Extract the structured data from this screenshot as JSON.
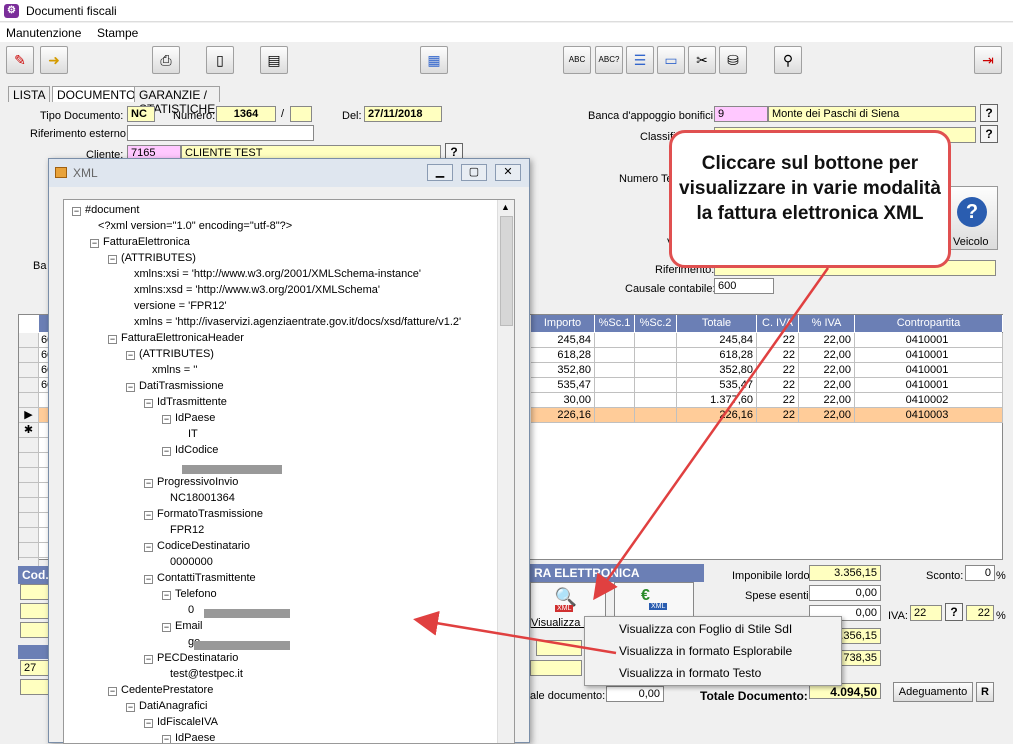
{
  "window": {
    "title": "Documenti fiscali"
  },
  "menu": [
    "Manutenzione",
    "Stampe"
  ],
  "tabs": [
    "LISTA",
    "DOCUMENTO",
    "GARANZIE / STATISTICHE"
  ],
  "form": {
    "tipo_label": "Tipo Documento:",
    "tipo_value": "NC",
    "numero_label": "Numero:",
    "numero_value": "1364",
    "numero_sep": "/",
    "del_label": "Del:",
    "del_value": "27/11/2018",
    "rif_label": "Riferimento esterno:",
    "cliente_label": "Cliente:",
    "cliente_code": "7165",
    "cliente_name": "CLIENTE TEST",
    "banca_label": "Banca d'appoggio bonifici:",
    "banca_code": "9",
    "banca_name": "Monte dei Paschi di Siena",
    "classif_label": "Classifi",
    "numero_te_label": "Numero Te",
    "veicolo_label": "Veicolo",
    "riferimento_label": "Riferimento:",
    "causale_label": "Causale contabile:",
    "causale_value": "600",
    "ba_label": "Ba",
    "v_label": "V"
  },
  "grid": {
    "headers": [
      "Importo",
      "%Sc.1",
      "%Sc.2",
      "Totale",
      "C. IVA",
      "% IVA",
      "Contropartita"
    ],
    "left_codes": [
      "60",
      "60",
      "60",
      "60"
    ],
    "rows": [
      [
        "245,84",
        "",
        "",
        "245,84",
        "22",
        "22,00",
        "0410001"
      ],
      [
        "618,28",
        "",
        "",
        "618,28",
        "22",
        "22,00",
        "0410001"
      ],
      [
        "352,80",
        "",
        "",
        "352,80",
        "22",
        "22,00",
        "0410001"
      ],
      [
        "535,47",
        "",
        "",
        "535,47",
        "22",
        "22,00",
        "0410001"
      ],
      [
        "30,00",
        "",
        "",
        "1.377,60",
        "22",
        "22,00",
        "0410002"
      ],
      [
        "226,16",
        "",
        "",
        "226,16",
        "22",
        "22,00",
        "0410003"
      ]
    ]
  },
  "bottom": {
    "section_title": "RA ELETTRONICA",
    "cod_label": "Cod.I",
    "left_value": "27",
    "visualizza_label": "Visualizza X",
    "imponibile_label": "Imponibile lordo:",
    "imponibile_value": "3.356,15",
    "sconto_label": "Sconto:",
    "sconto_value": "0",
    "pct": "%",
    "spese_label": "Spese esenti:",
    "spese_value": "0,00",
    "third_value": "0,00",
    "iva_label": "IVA:",
    "iva_code": "22",
    "iva_pct": "22",
    "val1": "3.356,15",
    "val2": "738,35",
    "totale_small_label": "ale documento:",
    "totale_small_value": "0,00",
    "totale_label": "Totale Documento:",
    "totale_value": "4.094,50",
    "adeguamento_label": "Adeguamento",
    "r_label": "R"
  },
  "callout": {
    "text": "Cliccare sul bottone per visualizzare in varie modalità la fattura elettronica XML"
  },
  "context_menu": [
    "Visualizza con Foglio di Stile SdI",
    "Visualizza in formato Esplorabile",
    "Visualizza in formato Testo"
  ],
  "xml": {
    "title": "XML",
    "nodes": [
      {
        "label": "#document"
      },
      {
        "label": "<?xml version=\"1.0\" encoding=\"utf-8\"?>"
      },
      {
        "label": "FatturaElettronica"
      },
      {
        "label": "(ATTRIBUTES)"
      },
      {
        "label": "xmlns:xsi = 'http://www.w3.org/2001/XMLSchema-instance'"
      },
      {
        "label": "xmlns:xsd = 'http://www.w3.org/2001/XMLSchema'"
      },
      {
        "label": "versione = 'FPR12'"
      },
      {
        "label": "xmlns = 'http://ivaservizi.agenziaentrate.gov.it/docs/xsd/fatture/v1.2'"
      },
      {
        "label": "FatturaElettronicaHeader"
      },
      {
        "label": "(ATTRIBUTES)"
      },
      {
        "label": "xmlns = ''"
      },
      {
        "label": "DatiTrasmissione"
      },
      {
        "label": "IdTrasmittente"
      },
      {
        "label": "IdPaese"
      },
      {
        "label": "IT"
      },
      {
        "label": "IdCodice"
      },
      {
        "label": ""
      },
      {
        "label": "ProgressivoInvio"
      },
      {
        "label": "NC18001364"
      },
      {
        "label": "FormatoTrasmissione"
      },
      {
        "label": "FPR12"
      },
      {
        "label": "CodiceDestinatario"
      },
      {
        "label": "0000000"
      },
      {
        "label": "ContattiTrasmittente"
      },
      {
        "label": "Telefono"
      },
      {
        "label": "0"
      },
      {
        "label": "Email"
      },
      {
        "label": "ge"
      },
      {
        "label": "PECDestinatario"
      },
      {
        "label": "test@testpec.it"
      },
      {
        "label": "CedentePrestatore"
      },
      {
        "label": "DatiAnagrafici"
      },
      {
        "label": "IdFiscaleIVA"
      },
      {
        "label": "IdPaese"
      }
    ]
  }
}
